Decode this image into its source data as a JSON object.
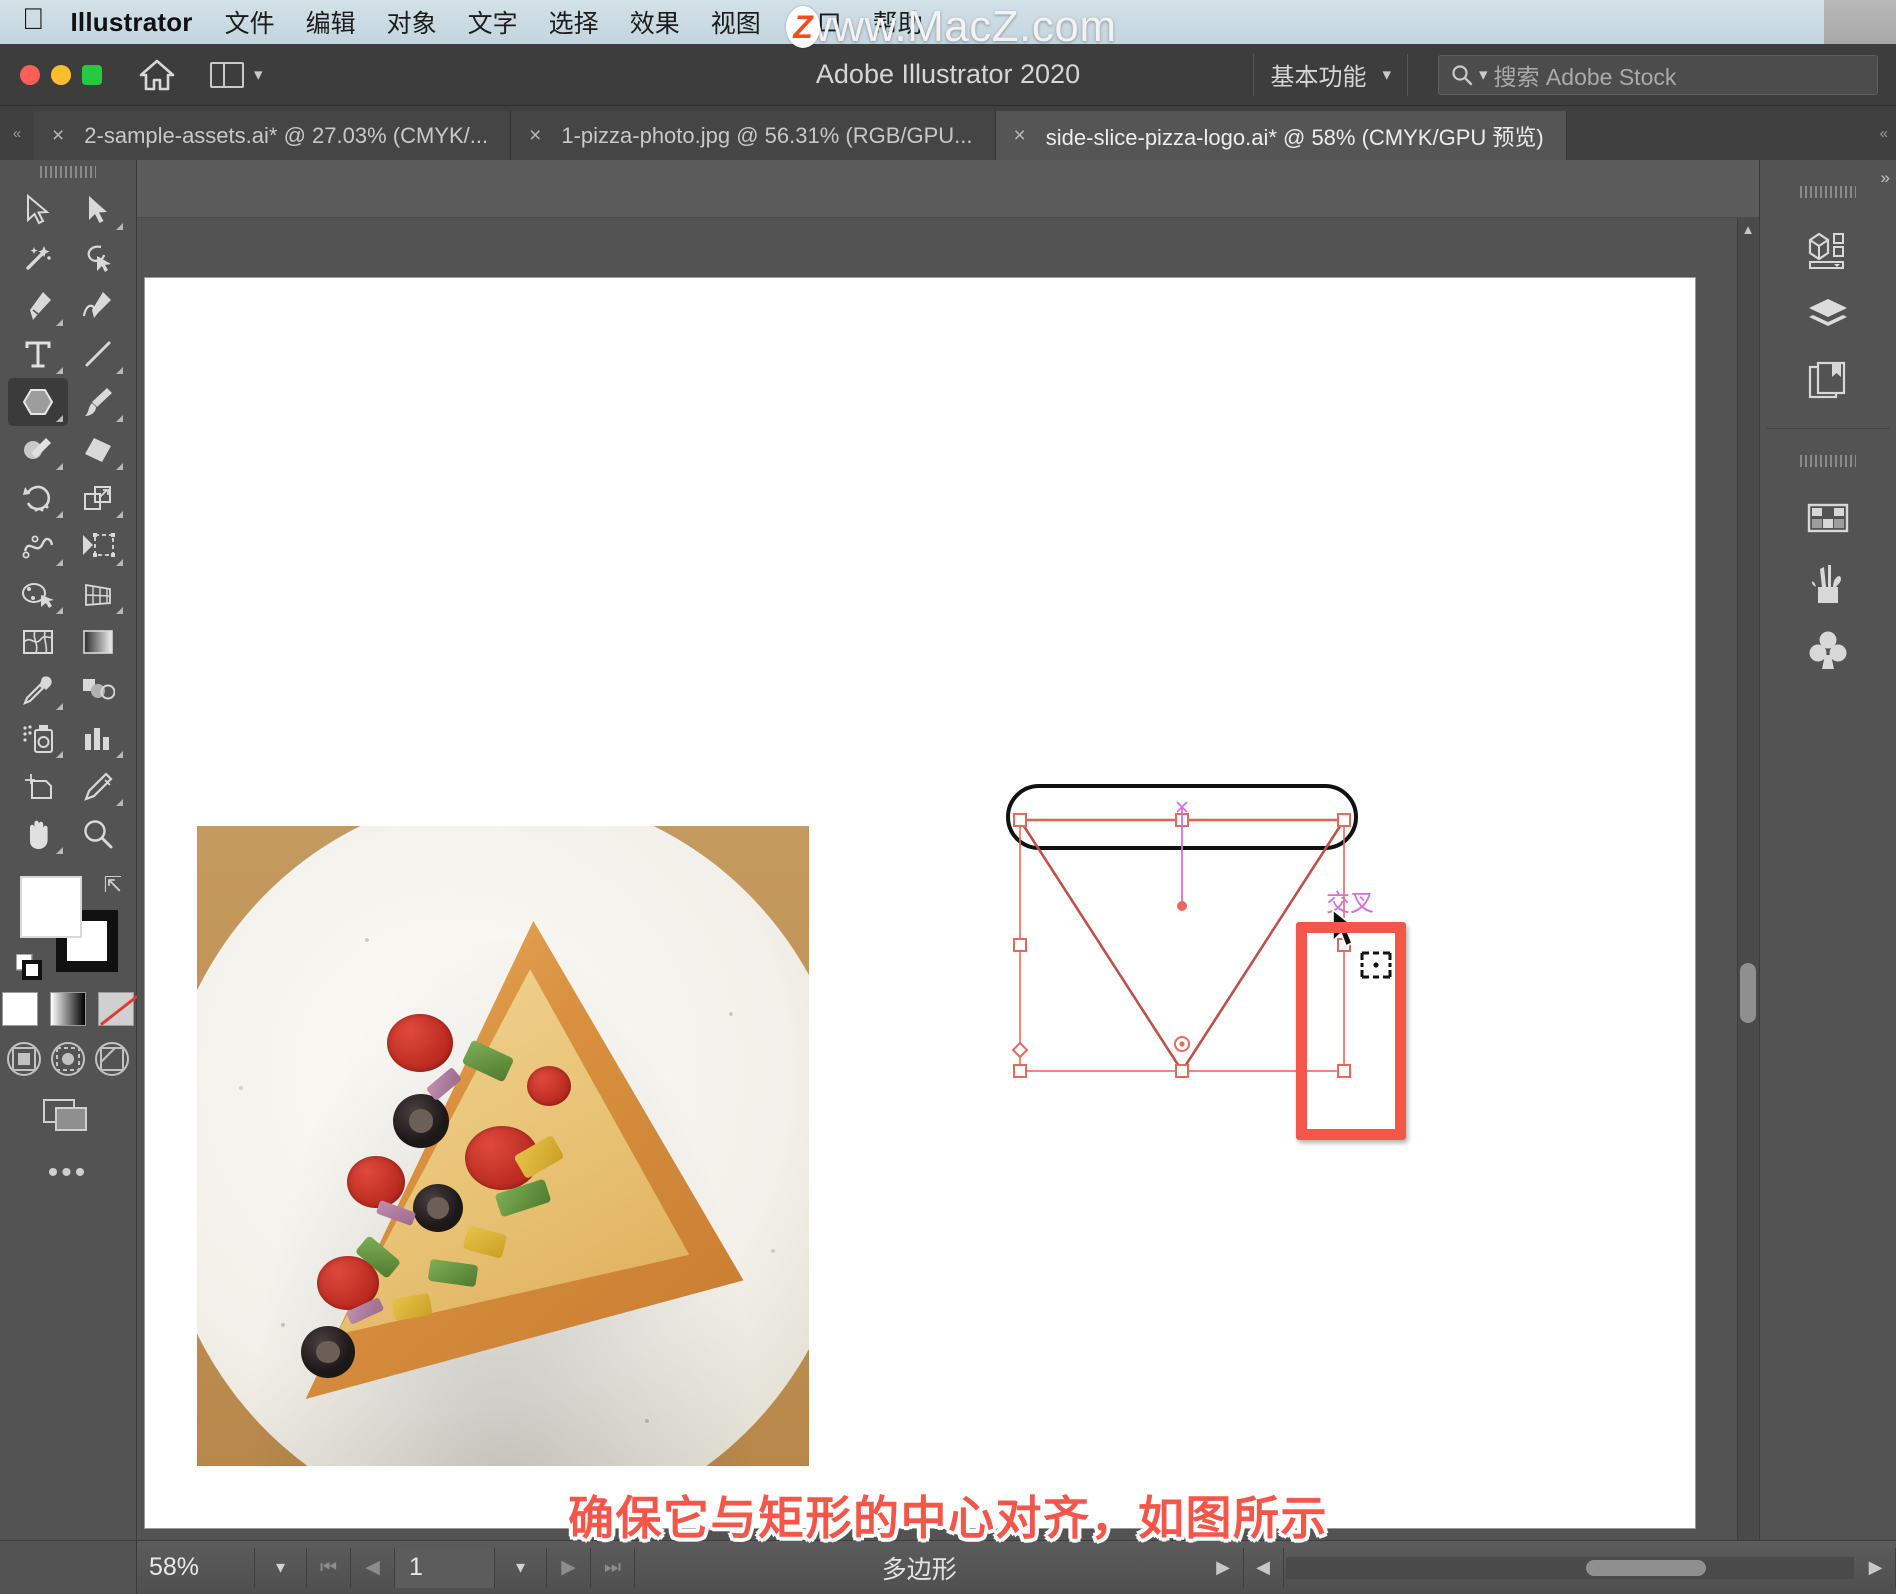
{
  "menubar": {
    "apple_icon": "apple-logo",
    "app_name": "Illustrator",
    "items": [
      "文件",
      "编辑",
      "对象",
      "文字",
      "选择",
      "效果",
      "视图",
      "窗口",
      "帮助"
    ]
  },
  "watermark": {
    "text": "www.MacZ.com",
    "badge": "Z"
  },
  "titlebar": {
    "title": "Adobe Illustrator 2020",
    "home_icon": "home-icon",
    "arrange_icon": "arrange-documents-icon",
    "workspace": "基本功能",
    "workspace_chevron": "chevron-down-icon",
    "search": {
      "icon": "search-icon",
      "placeholder": "搜索 Adobe Stock",
      "value": ""
    }
  },
  "tabs": [
    {
      "close": "×",
      "label": "2-sample-assets.ai* @ 27.03% (CMYK/...",
      "active": false
    },
    {
      "close": "×",
      "label": "1-pizza-photo.jpg @ 56.31% (RGB/GPU...",
      "active": false
    },
    {
      "close": "×",
      "label": "side-slice-pizza-logo.ai* @ 58% (CMYK/GPU 预览)",
      "active": true
    }
  ],
  "toolbar": {
    "tools": [
      {
        "name": "selection-tool",
        "selected": false,
        "has_flyout": false
      },
      {
        "name": "direct-selection-tool",
        "selected": false,
        "has_flyout": true
      },
      {
        "name": "magic-wand-tool",
        "selected": false,
        "has_flyout": false
      },
      {
        "name": "lasso-tool",
        "selected": false,
        "has_flyout": false
      },
      {
        "name": "pen-tool",
        "selected": false,
        "has_flyout": true
      },
      {
        "name": "curvature-tool",
        "selected": false,
        "has_flyout": false
      },
      {
        "name": "type-tool",
        "selected": false,
        "has_flyout": true
      },
      {
        "name": "line-segment-tool",
        "selected": false,
        "has_flyout": true
      },
      {
        "name": "polygon-tool",
        "selected": true,
        "has_flyout": true
      },
      {
        "name": "paintbrush-tool",
        "selected": false,
        "has_flyout": true
      },
      {
        "name": "shaper-tool",
        "selected": false,
        "has_flyout": true
      },
      {
        "name": "eraser-tool",
        "selected": false,
        "has_flyout": true
      },
      {
        "name": "rotate-tool",
        "selected": false,
        "has_flyout": true
      },
      {
        "name": "scale-tool",
        "selected": false,
        "has_flyout": true
      },
      {
        "name": "width-tool",
        "selected": false,
        "has_flyout": true
      },
      {
        "name": "free-transform-tool",
        "selected": false,
        "has_flyout": true
      },
      {
        "name": "shape-builder-tool",
        "selected": false,
        "has_flyout": true
      },
      {
        "name": "perspective-grid-tool",
        "selected": false,
        "has_flyout": true
      },
      {
        "name": "mesh-tool",
        "selected": false,
        "has_flyout": false
      },
      {
        "name": "gradient-tool",
        "selected": false,
        "has_flyout": false
      },
      {
        "name": "eyedropper-tool",
        "selected": false,
        "has_flyout": true
      },
      {
        "name": "blend-tool",
        "selected": false,
        "has_flyout": false
      },
      {
        "name": "symbol-sprayer-tool",
        "selected": false,
        "has_flyout": true
      },
      {
        "name": "column-graph-tool",
        "selected": false,
        "has_flyout": true
      },
      {
        "name": "artboard-tool",
        "selected": false,
        "has_flyout": false
      },
      {
        "name": "slice-tool",
        "selected": false,
        "has_flyout": true
      },
      {
        "name": "hand-tool",
        "selected": false,
        "has_flyout": true
      },
      {
        "name": "zoom-tool",
        "selected": false,
        "has_flyout": false
      }
    ],
    "fill_color": "#ffffff",
    "stroke_color": "#111111",
    "swap_icon": "swap-fill-stroke-icon",
    "default_icon": "default-fill-stroke-icon",
    "mini_swatches": [
      "color-swatch",
      "gradient-swatch",
      "none-swatch"
    ],
    "draw_modes": [
      "draw-normal-icon",
      "draw-behind-icon",
      "draw-inside-icon"
    ],
    "screen_mode_icon": "change-screen-mode-icon",
    "more_tools": "•••"
  },
  "canvas": {
    "artboard_bg": "#ffffff",
    "selection_color": "#e8685e",
    "smart_guide_label": "交叉",
    "smart_guide_color": "#d36fd8",
    "cursor": "selection-cursor",
    "highlight_color": "#f4564a",
    "photo": {
      "name": "pizza-slice-photo",
      "alt": "pizza slice on a speckled white plate over wood table"
    },
    "logo": {
      "name": "side-slice-pizza-logo",
      "shapes": [
        "rounded-rectangle",
        "triangle",
        "vertical-rectangle"
      ]
    }
  },
  "rightpanel": {
    "collapse_icon": "collapse-panel-icon",
    "items": [
      {
        "name": "properties-panel-icon"
      },
      {
        "name": "layers-panel-icon"
      },
      {
        "name": "libraries-panel-icon"
      },
      {
        "name": "swatches-panel-icon"
      },
      {
        "name": "brushes-panel-icon"
      },
      {
        "name": "symbols-panel-icon"
      }
    ]
  },
  "caption": {
    "text": "确保它与矩形的中心对齐，如图所示",
    "color": "#f4564a"
  },
  "statusbar": {
    "zoom": "58%",
    "zoom_chevron": "chevron-down-icon",
    "first_page_icon": "first-artboard-icon",
    "prev_page_icon": "previous-artboard-icon",
    "page": "1",
    "page_chevron": "chevron-down-icon",
    "next_page_icon": "next-artboard-icon",
    "last_page_icon": "last-artboard-icon",
    "status_text": "多边形",
    "status_arrow": "status-menu-arrow"
  }
}
